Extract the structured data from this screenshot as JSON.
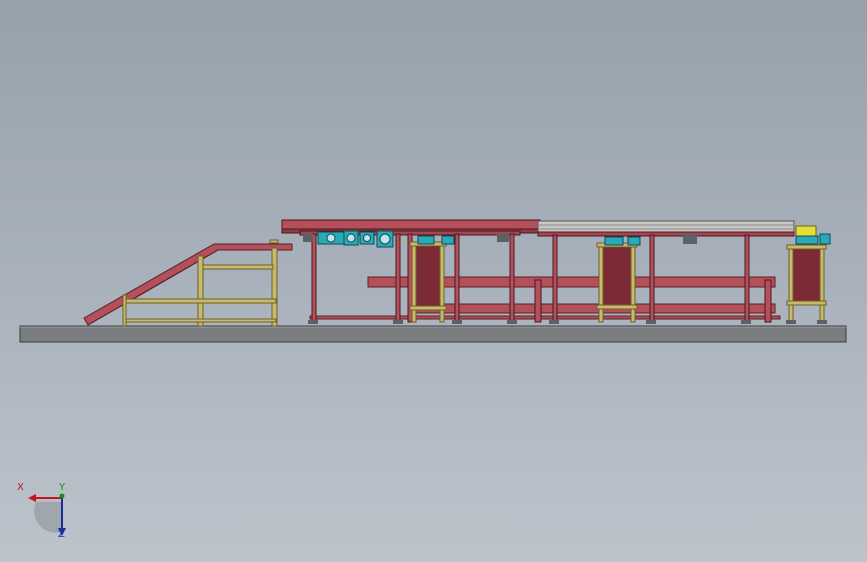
{
  "viewport": {
    "colors": {
      "background_top": "#97a1ac",
      "background_bottom": "#bcc3cb",
      "frame_red": "#b4505a",
      "frame_yellow": "#c9b96a",
      "base_plate": "#7b7e80",
      "motor_teal": "#2aa9b8",
      "panel_dark": "#7c2a35"
    }
  },
  "triad": {
    "x_label": "X",
    "y_label": "Y",
    "z_label": "Z",
    "colors": {
      "x": "#c8141e",
      "y": "#1a8a1a",
      "z": "#1f2d9a"
    }
  }
}
